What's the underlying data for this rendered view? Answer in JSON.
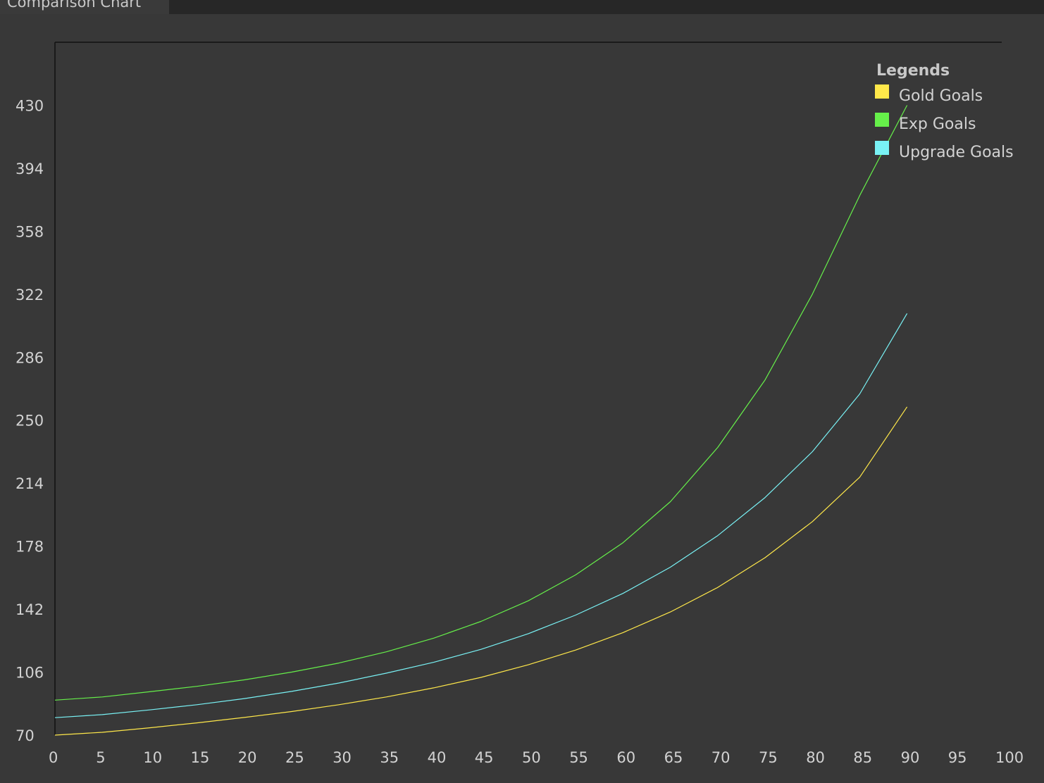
{
  "window": {
    "tab_title": "Comparison Chart"
  },
  "colors": {
    "background": "#383838",
    "axis": "#111111",
    "text": "#d2d2d2",
    "gold": "#ffe84a",
    "exp": "#66f04a",
    "upgrade": "#79f2f5"
  },
  "chart_data": {
    "type": "line",
    "title": "",
    "xlabel": "",
    "ylabel": "",
    "xlim": [
      0,
      100
    ],
    "ylim": [
      70,
      466
    ],
    "x_ticks": [
      "0",
      "5",
      "10",
      "15",
      "20",
      "25",
      "30",
      "35",
      "40",
      "45",
      "50",
      "55",
      "60",
      "65",
      "70",
      "75",
      "80",
      "85",
      "90",
      "95",
      "100"
    ],
    "y_ticks": [
      "70",
      "106",
      "142",
      "178",
      "214",
      "250",
      "286",
      "322",
      "358",
      "394",
      "430"
    ],
    "grid": false,
    "legend": {
      "title": "Legends",
      "placement": "top-right"
    },
    "x": [
      0,
      5,
      10,
      15,
      20,
      25,
      30,
      35,
      40,
      45,
      50,
      55,
      60,
      65,
      70,
      75,
      80,
      85,
      90
    ],
    "series": [
      {
        "name": "Gold Goals",
        "color": "#ffe84a",
        "values": [
          70.0,
          71.6,
          74.2,
          77.0,
          80.1,
          83.5,
          87.4,
          91.8,
          97.0,
          103.0,
          110.2,
          118.6,
          128.6,
          140.4,
          154.4,
          171.4,
          192.0,
          217.4,
          257.6
        ]
      },
      {
        "name": "Exp Goals",
        "color": "#66f04a",
        "values": [
          90.0,
          91.8,
          94.8,
          97.9,
          101.6,
          106.0,
          111.2,
          117.6,
          125.4,
          135.0,
          146.8,
          161.6,
          180.0,
          203.4,
          234.4,
          273.0,
          322.0,
          378.4,
          430.0
        ]
      },
      {
        "name": "Upgrade Goals",
        "color": "#79f2f5",
        "values": [
          80.0,
          81.7,
          84.4,
          87.4,
          90.9,
          95.0,
          99.8,
          105.4,
          111.6,
          119.0,
          128.0,
          138.6,
          151.0,
          166.0,
          184.0,
          205.8,
          232.0,
          265.0,
          311.0
        ]
      }
    ]
  }
}
